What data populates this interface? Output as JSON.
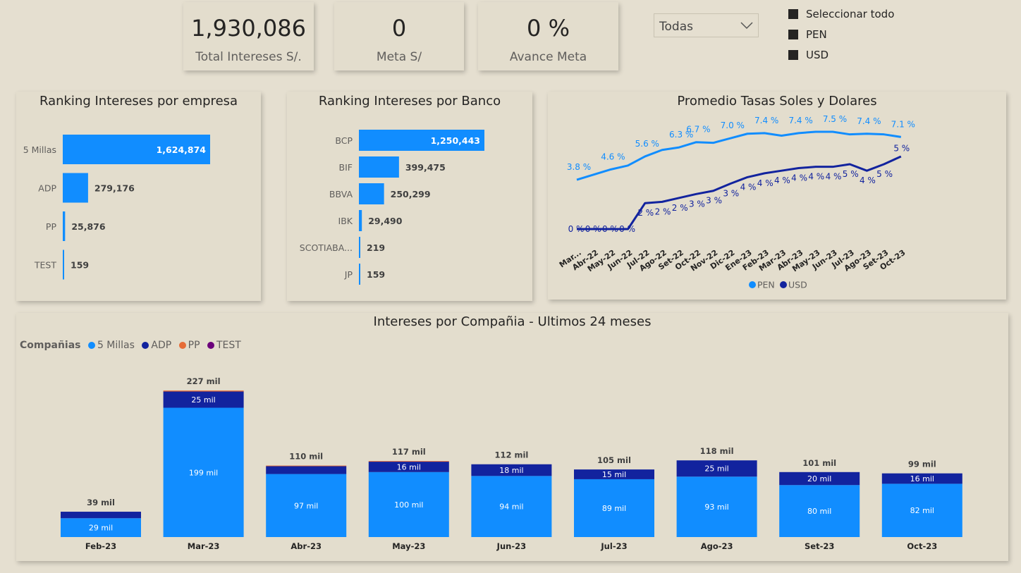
{
  "kpis": [
    {
      "value": "1,930,086",
      "label": "Total Intereses S/."
    },
    {
      "value": "0",
      "label": "Meta S/"
    },
    {
      "value": "0 %",
      "label": "Avance Meta"
    }
  ],
  "filter": {
    "selected": "Todas"
  },
  "currency_slicer": {
    "items": [
      "Seleccionar todo",
      "PEN",
      "USD"
    ]
  },
  "colors": {
    "light_blue": "#118dff",
    "dark_blue": "#12239e",
    "orange": "#e66c37",
    "purple": "#6b007b"
  },
  "chart_data": [
    {
      "type": "bar",
      "orientation": "horizontal",
      "title": "Ranking Intereses por empresa",
      "categories": [
        "5 Millas",
        "ADP",
        "PP",
        "TEST"
      ],
      "values": [
        1624874,
        279176,
        25876,
        159
      ],
      "labels": [
        "1,624,874",
        "279,176",
        "25,876",
        "159"
      ]
    },
    {
      "type": "bar",
      "orientation": "horizontal",
      "title": "Ranking Intereses por Banco",
      "categories": [
        "BCP",
        "BIF",
        "BBVA",
        "IBK",
        "SCOTIABA...",
        "JP"
      ],
      "values": [
        1250443,
        399475,
        250299,
        29490,
        219,
        159
      ],
      "labels": [
        "1,250,443",
        "399,475",
        "250,299",
        "29,490",
        "219",
        "159"
      ]
    },
    {
      "type": "line",
      "title": "Promedio Tasas Soles y Dolares",
      "categories": [
        "Mar...",
        "Abr-22",
        "May-22",
        "Jun-22",
        "Jul-22",
        "Ago-22",
        "Set-22",
        "Oct-22",
        "Nov-22",
        "Dic-22",
        "Ene-23",
        "Feb-23",
        "Mar-23",
        "Abr-23",
        "May-23",
        "Jun-23",
        "Jul-23",
        "Ago-23",
        "Set-23",
        "Oct-23"
      ],
      "series": [
        {
          "name": "PEN",
          "values": [
            3.8,
            4.2,
            4.6,
            4.9,
            5.6,
            6.1,
            6.3,
            6.7,
            6.65,
            7.0,
            7.35,
            7.4,
            7.2,
            7.4,
            7.5,
            7.5,
            7.3,
            7.35,
            7.3,
            7.1
          ],
          "labels": {
            "0": "3.8 %",
            "2": "4.6 %",
            "4": "5.6 %",
            "6": "6.3 %",
            "7": "6.7 %",
            "9": "7.0 %",
            "11": "7.4 %",
            "13": "7.4 %",
            "15": "7.5 %",
            "17": "7.4 %",
            "19": "7.1 %"
          }
        },
        {
          "name": "USD",
          "values": [
            0,
            0,
            0,
            0,
            2,
            2.1,
            2.4,
            2.7,
            2.95,
            3.5,
            4.0,
            4.3,
            4.5,
            4.7,
            4.8,
            4.8,
            5.0,
            4.5,
            5.0,
            5.6
          ],
          "labels": {
            "0": "0 %",
            "1": "0 %",
            "2": "0 %",
            "3": "0 %",
            "4": "2 %",
            "5": "2 %",
            "6": "2 %",
            "7": "3 %",
            "8": "3 %",
            "9": "3 %",
            "10": "4 %",
            "11": "4 %",
            "12": "4 %",
            "13": "4 %",
            "14": "4 %",
            "15": "4 %",
            "16": "5 %",
            "17": "4 %",
            "18": "5 %",
            "19": "5 %"
          }
        }
      ],
      "legend": [
        "PEN",
        "USD"
      ],
      "legend_position": "bottom"
    },
    {
      "type": "bar",
      "stacked": true,
      "title": "Intereses por Compañia - Ultimos 24 meses",
      "legend_title": "Compañias",
      "legend": [
        "5 Millas",
        "ADP",
        "PP",
        "TEST"
      ],
      "legend_position": "top-left",
      "categories": [
        "Feb-23",
        "Mar-23",
        "Abr-23",
        "May-23",
        "Jun-23",
        "Jul-23",
        "Ago-23",
        "Set-23",
        "Oct-23"
      ],
      "series": [
        {
          "name": "5 Millas",
          "values": [
            29,
            199,
            97,
            100,
            94,
            89,
            93,
            80,
            82
          ],
          "labels": [
            "29 mil",
            "199 mil",
            "97 mil",
            "100 mil",
            "94 mil",
            "89 mil",
            "93 mil",
            "80 mil",
            "82 mil"
          ]
        },
        {
          "name": "ADP",
          "values": [
            10,
            25,
            12,
            16,
            18,
            15,
            25,
            20,
            16
          ],
          "labels": [
            "",
            "25 mil",
            "",
            "16 mil",
            "18 mil",
            "15 mil",
            "25 mil",
            "20 mil",
            "16 mil"
          ]
        },
        {
          "name": "PP",
          "values": [
            0,
            1.5,
            1,
            1,
            0,
            0,
            0,
            0,
            0
          ],
          "labels": [
            "",
            "",
            "",
            "",
            "",
            "",
            "",
            "",
            ""
          ]
        },
        {
          "name": "TEST",
          "values": [
            0,
            0,
            0,
            0,
            0,
            0,
            0,
            0,
            0
          ],
          "labels": [
            "",
            "",
            "",
            "",
            "",
            "",
            "",
            "",
            ""
          ]
        }
      ],
      "totals": [
        "39 mil",
        "227 mil",
        "110 mil",
        "117 mil",
        "112 mil",
        "105 mil",
        "118 mil",
        "101 mil",
        "99 mil"
      ],
      "units": "mil"
    }
  ]
}
